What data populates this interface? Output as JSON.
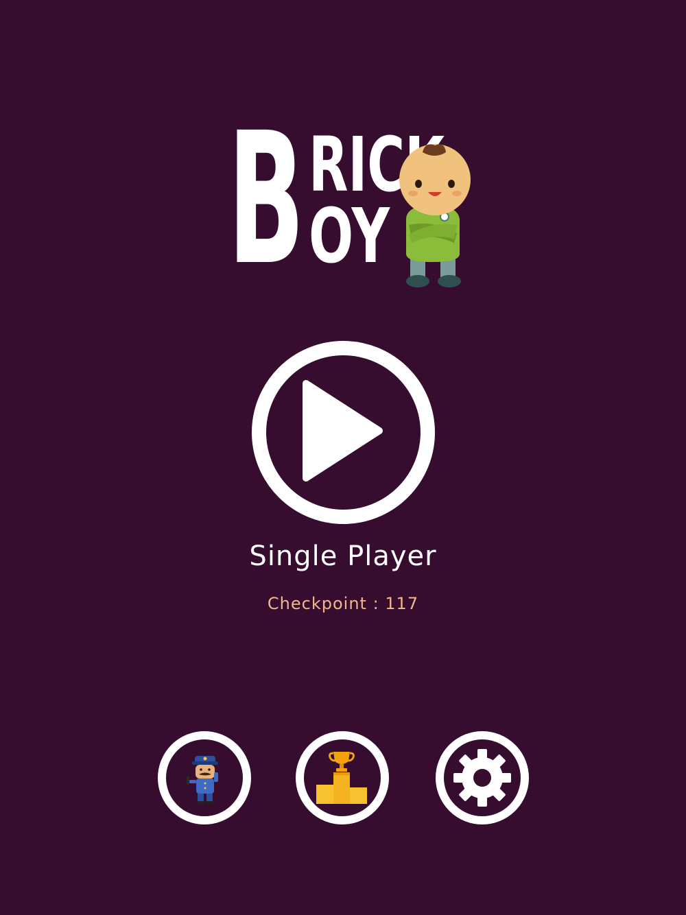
{
  "logo": {
    "line1_initial": "B",
    "line1_rest": "RICK",
    "line2_rest": "OY",
    "icon": "brick-boy-character"
  },
  "main": {
    "play_icon": "play-icon",
    "mode_label": "Single Player",
    "checkpoint_text": "Checkpoint : 117"
  },
  "buttons": {
    "character_icon": "policeman-character-icon",
    "leaderboard_icon": "trophy-podium-icon",
    "settings_icon": "gear-icon"
  },
  "colors": {
    "background": "#360d2f",
    "foreground": "#ffffff",
    "checkpoint": "#f0b78a"
  }
}
